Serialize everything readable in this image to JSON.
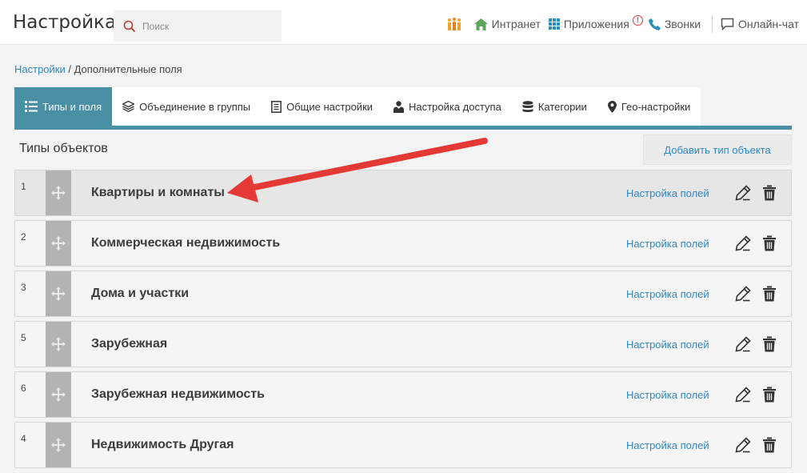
{
  "app": {
    "title": "Настройка"
  },
  "search": {
    "placeholder": "Поиск"
  },
  "topnav": {
    "intranet": "Интранет",
    "apps": "Приложения",
    "apps_alert": "!",
    "calls": "Звонки",
    "chat": "Онлайн-чат"
  },
  "breadcrumb": {
    "root": "Настройки",
    "separator": " / ",
    "current": "Дополнительные поля"
  },
  "tabs": [
    {
      "label": "Типы и поля",
      "icon": "list-icon",
      "active": true
    },
    {
      "label": "Объединение в группы",
      "icon": "layers-icon",
      "active": false
    },
    {
      "label": "Общие настройки",
      "icon": "document-icon",
      "active": false
    },
    {
      "label": "Настройка доступа",
      "icon": "user-tie-icon",
      "active": false
    },
    {
      "label": "Категории",
      "icon": "database-icon",
      "active": false
    },
    {
      "label": "Гео-настройки",
      "icon": "map-pin-icon",
      "active": false
    }
  ],
  "section": {
    "title": "Типы объектов",
    "add_button": "Добавить тип объекта"
  },
  "object_types": [
    {
      "num": "1",
      "name": "Квартиры и комнаты",
      "link": "Настройка полей"
    },
    {
      "num": "2",
      "name": "Коммерческая недвижимость",
      "link": "Настройка полей"
    },
    {
      "num": "3",
      "name": "Дома и участки",
      "link": "Настройка полей"
    },
    {
      "num": "5",
      "name": "Зарубежная",
      "link": "Настройка полей"
    },
    {
      "num": "6",
      "name": "Зарубежная недвижимость",
      "link": "Настройка полей"
    },
    {
      "num": "4",
      "name": "Недвижимость Другая",
      "link": "Настройка полей"
    }
  ],
  "colors": {
    "accent": "#4a90a4",
    "link": "#2e86c1",
    "arrow": "#e53935"
  }
}
